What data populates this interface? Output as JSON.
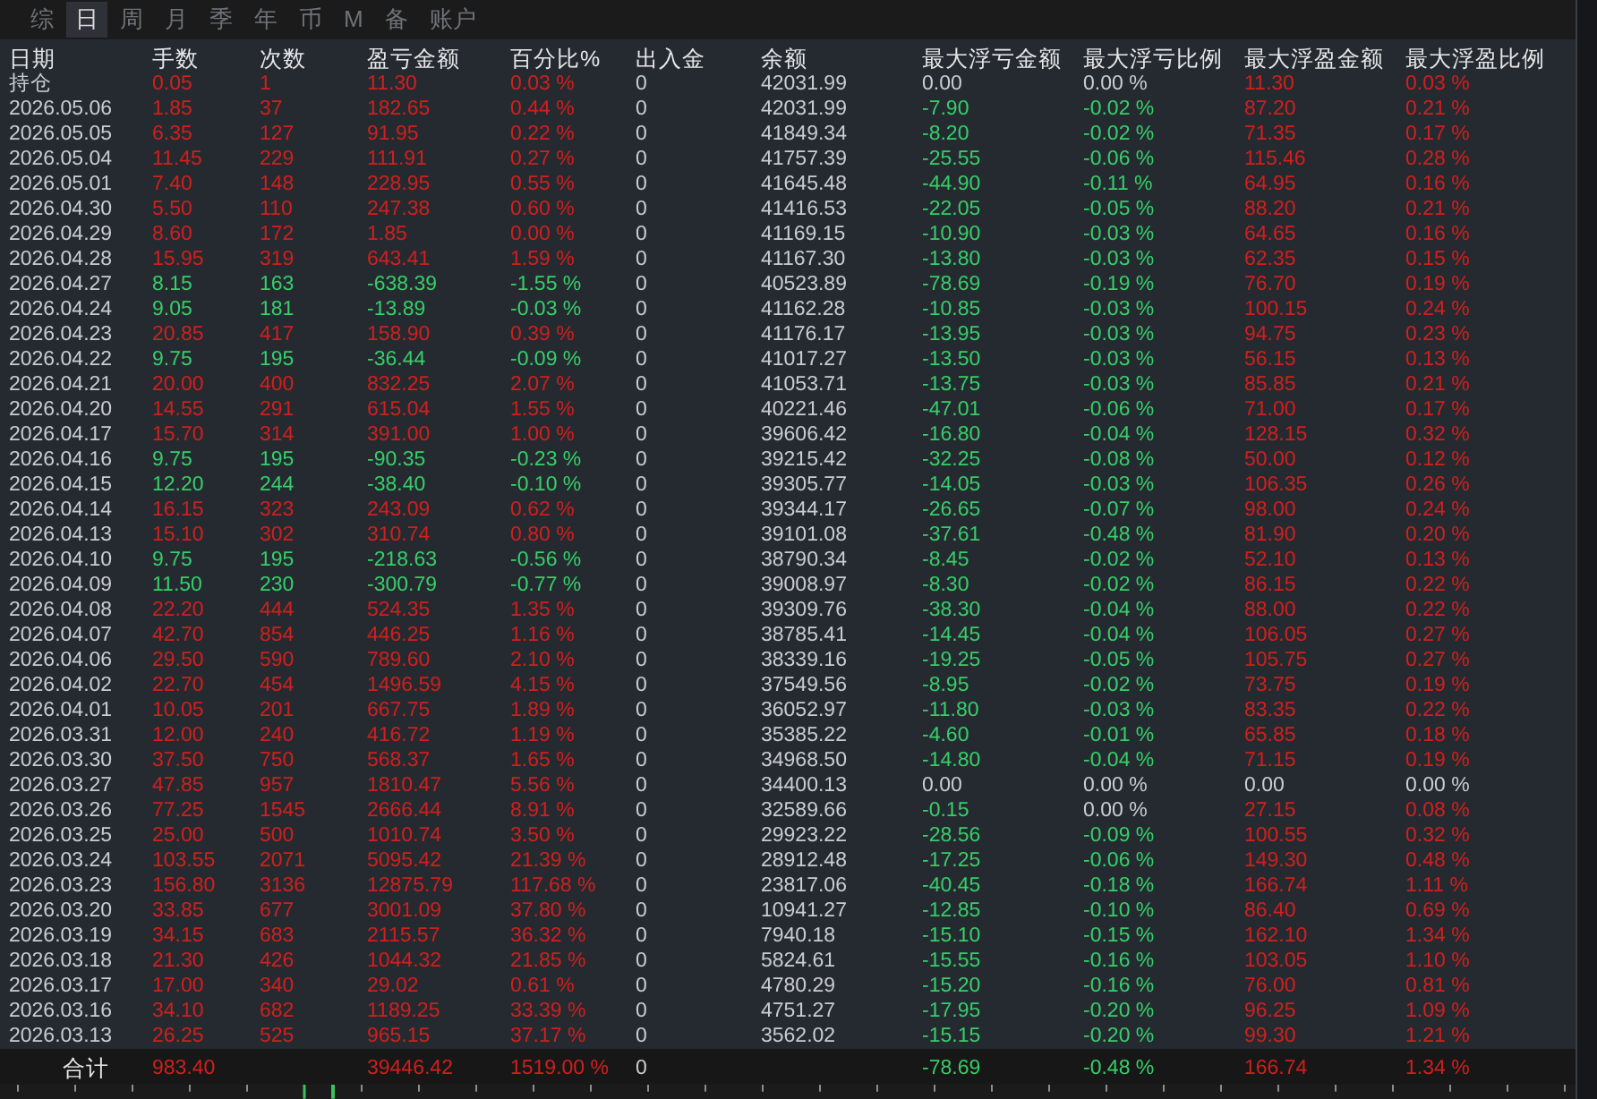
{
  "tabs": [
    {
      "label": "综",
      "selected": false
    },
    {
      "label": "日",
      "selected": true
    },
    {
      "label": "周",
      "selected": false
    },
    {
      "label": "月",
      "selected": false
    },
    {
      "label": "季",
      "selected": false
    },
    {
      "label": "年",
      "selected": false
    },
    {
      "label": "币",
      "selected": false
    },
    {
      "label": "M",
      "selected": false
    },
    {
      "label": "备",
      "selected": false
    },
    {
      "label": "账户",
      "selected": false
    }
  ],
  "columns": [
    "日期",
    "手数",
    "次数",
    "盈亏金额",
    "百分比%",
    "出入金",
    "余额",
    "最大浮亏金额",
    "最大浮亏比例",
    "最大浮盈金额",
    "最大浮盈比例"
  ],
  "rows": [
    {
      "cells": [
        "持仓",
        "0.05",
        "1",
        "11.30",
        "0.03 %",
        "0",
        "42031.99",
        "0.00",
        "0.00 %",
        "11.30",
        "0.03 %"
      ],
      "negative": false,
      "float_flat": [
        true,
        true,
        false,
        false
      ]
    },
    {
      "cells": [
        "2026.05.06",
        "1.85",
        "37",
        "182.65",
        "0.44 %",
        "0",
        "42031.99",
        "-7.90",
        "-0.02 %",
        "87.20",
        "0.21 %"
      ],
      "negative": false,
      "float_flat": [
        false,
        false,
        false,
        false
      ]
    },
    {
      "cells": [
        "2026.05.05",
        "6.35",
        "127",
        "91.95",
        "0.22 %",
        "0",
        "41849.34",
        "-8.20",
        "-0.02 %",
        "71.35",
        "0.17 %"
      ],
      "negative": false,
      "float_flat": [
        false,
        false,
        false,
        false
      ]
    },
    {
      "cells": [
        "2026.05.04",
        "11.45",
        "229",
        "111.91",
        "0.27 %",
        "0",
        "41757.39",
        "-25.55",
        "-0.06 %",
        "115.46",
        "0.28 %"
      ],
      "negative": false,
      "float_flat": [
        false,
        false,
        false,
        false
      ]
    },
    {
      "cells": [
        "2026.05.01",
        "7.40",
        "148",
        "228.95",
        "0.55 %",
        "0",
        "41645.48",
        "-44.90",
        "-0.11 %",
        "64.95",
        "0.16 %"
      ],
      "negative": false,
      "float_flat": [
        false,
        false,
        false,
        false
      ]
    },
    {
      "cells": [
        "2026.04.30",
        "5.50",
        "110",
        "247.38",
        "0.60 %",
        "0",
        "41416.53",
        "-22.05",
        "-0.05 %",
        "88.20",
        "0.21 %"
      ],
      "negative": false,
      "float_flat": [
        false,
        false,
        false,
        false
      ]
    },
    {
      "cells": [
        "2026.04.29",
        "8.60",
        "172",
        "1.85",
        "0.00 %",
        "0",
        "41169.15",
        "-10.90",
        "-0.03 %",
        "64.65",
        "0.16 %"
      ],
      "negative": false,
      "float_flat": [
        false,
        false,
        false,
        false
      ]
    },
    {
      "cells": [
        "2026.04.28",
        "15.95",
        "319",
        "643.41",
        "1.59 %",
        "0",
        "41167.30",
        "-13.80",
        "-0.03 %",
        "62.35",
        "0.15 %"
      ],
      "negative": false,
      "float_flat": [
        false,
        false,
        false,
        false
      ]
    },
    {
      "cells": [
        "2026.04.27",
        "8.15",
        "163",
        "-638.39",
        "-1.55 %",
        "0",
        "40523.89",
        "-78.69",
        "-0.19 %",
        "76.70",
        "0.19 %"
      ],
      "negative": true,
      "float_flat": [
        false,
        false,
        false,
        false
      ]
    },
    {
      "cells": [
        "2026.04.24",
        "9.05",
        "181",
        "-13.89",
        "-0.03 %",
        "0",
        "41162.28",
        "-10.85",
        "-0.03 %",
        "100.15",
        "0.24 %"
      ],
      "negative": true,
      "float_flat": [
        false,
        false,
        false,
        false
      ]
    },
    {
      "cells": [
        "2026.04.23",
        "20.85",
        "417",
        "158.90",
        "0.39 %",
        "0",
        "41176.17",
        "-13.95",
        "-0.03 %",
        "94.75",
        "0.23 %"
      ],
      "negative": false,
      "float_flat": [
        false,
        false,
        false,
        false
      ]
    },
    {
      "cells": [
        "2026.04.22",
        "9.75",
        "195",
        "-36.44",
        "-0.09 %",
        "0",
        "41017.27",
        "-13.50",
        "-0.03 %",
        "56.15",
        "0.13 %"
      ],
      "negative": true,
      "float_flat": [
        false,
        false,
        false,
        false
      ]
    },
    {
      "cells": [
        "2026.04.21",
        "20.00",
        "400",
        "832.25",
        "2.07 %",
        "0",
        "41053.71",
        "-13.75",
        "-0.03 %",
        "85.85",
        "0.21 %"
      ],
      "negative": false,
      "float_flat": [
        false,
        false,
        false,
        false
      ]
    },
    {
      "cells": [
        "2026.04.20",
        "14.55",
        "291",
        "615.04",
        "1.55 %",
        "0",
        "40221.46",
        "-47.01",
        "-0.06 %",
        "71.00",
        "0.17 %"
      ],
      "negative": false,
      "float_flat": [
        false,
        false,
        false,
        false
      ]
    },
    {
      "cells": [
        "2026.04.17",
        "15.70",
        "314",
        "391.00",
        "1.00 %",
        "0",
        "39606.42",
        "-16.80",
        "-0.04 %",
        "128.15",
        "0.32 %"
      ],
      "negative": false,
      "float_flat": [
        false,
        false,
        false,
        false
      ]
    },
    {
      "cells": [
        "2026.04.16",
        "9.75",
        "195",
        "-90.35",
        "-0.23 %",
        "0",
        "39215.42",
        "-32.25",
        "-0.08 %",
        "50.00",
        "0.12 %"
      ],
      "negative": true,
      "float_flat": [
        false,
        false,
        false,
        false
      ]
    },
    {
      "cells": [
        "2026.04.15",
        "12.20",
        "244",
        "-38.40",
        "-0.10 %",
        "0",
        "39305.77",
        "-14.05",
        "-0.03 %",
        "106.35",
        "0.26 %"
      ],
      "negative": true,
      "float_flat": [
        false,
        false,
        false,
        false
      ]
    },
    {
      "cells": [
        "2026.04.14",
        "16.15",
        "323",
        "243.09",
        "0.62 %",
        "0",
        "39344.17",
        "-26.65",
        "-0.07 %",
        "98.00",
        "0.24 %"
      ],
      "negative": false,
      "float_flat": [
        false,
        false,
        false,
        false
      ]
    },
    {
      "cells": [
        "2026.04.13",
        "15.10",
        "302",
        "310.74",
        "0.80 %",
        "0",
        "39101.08",
        "-37.61",
        "-0.48 %",
        "81.90",
        "0.20 %"
      ],
      "negative": false,
      "float_flat": [
        false,
        false,
        false,
        false
      ]
    },
    {
      "cells": [
        "2026.04.10",
        "9.75",
        "195",
        "-218.63",
        "-0.56 %",
        "0",
        "38790.34",
        "-8.45",
        "-0.02 %",
        "52.10",
        "0.13 %"
      ],
      "negative": true,
      "float_flat": [
        false,
        false,
        false,
        false
      ]
    },
    {
      "cells": [
        "2026.04.09",
        "11.50",
        "230",
        "-300.79",
        "-0.77 %",
        "0",
        "39008.97",
        "-8.30",
        "-0.02 %",
        "86.15",
        "0.22 %"
      ],
      "negative": true,
      "float_flat": [
        false,
        false,
        false,
        false
      ]
    },
    {
      "cells": [
        "2026.04.08",
        "22.20",
        "444",
        "524.35",
        "1.35 %",
        "0",
        "39309.76",
        "-38.30",
        "-0.04 %",
        "88.00",
        "0.22 %"
      ],
      "negative": false,
      "float_flat": [
        false,
        false,
        false,
        false
      ]
    },
    {
      "cells": [
        "2026.04.07",
        "42.70",
        "854",
        "446.25",
        "1.16 %",
        "0",
        "38785.41",
        "-14.45",
        "-0.04 %",
        "106.05",
        "0.27 %"
      ],
      "negative": false,
      "float_flat": [
        false,
        false,
        false,
        false
      ]
    },
    {
      "cells": [
        "2026.04.06",
        "29.50",
        "590",
        "789.60",
        "2.10 %",
        "0",
        "38339.16",
        "-19.25",
        "-0.05 %",
        "105.75",
        "0.27 %"
      ],
      "negative": false,
      "float_flat": [
        false,
        false,
        false,
        false
      ]
    },
    {
      "cells": [
        "2026.04.02",
        "22.70",
        "454",
        "1496.59",
        "4.15 %",
        "0",
        "37549.56",
        "-8.95",
        "-0.02 %",
        "73.75",
        "0.19 %"
      ],
      "negative": false,
      "float_flat": [
        false,
        false,
        false,
        false
      ]
    },
    {
      "cells": [
        "2026.04.01",
        "10.05",
        "201",
        "667.75",
        "1.89 %",
        "0",
        "36052.97",
        "-11.80",
        "-0.03 %",
        "83.35",
        "0.22 %"
      ],
      "negative": false,
      "float_flat": [
        false,
        false,
        false,
        false
      ]
    },
    {
      "cells": [
        "2026.03.31",
        "12.00",
        "240",
        "416.72",
        "1.19 %",
        "0",
        "35385.22",
        "-4.60",
        "-0.01 %",
        "65.85",
        "0.18 %"
      ],
      "negative": false,
      "float_flat": [
        false,
        false,
        false,
        false
      ]
    },
    {
      "cells": [
        "2026.03.30",
        "37.50",
        "750",
        "568.37",
        "1.65 %",
        "0",
        "34968.50",
        "-14.80",
        "-0.04 %",
        "71.15",
        "0.19 %"
      ],
      "negative": false,
      "float_flat": [
        false,
        false,
        false,
        false
      ]
    },
    {
      "cells": [
        "2026.03.27",
        "47.85",
        "957",
        "1810.47",
        "5.56 %",
        "0",
        "34400.13",
        "0.00",
        "0.00 %",
        "0.00",
        "0.00 %"
      ],
      "negative": false,
      "float_flat": [
        true,
        true,
        true,
        true
      ]
    },
    {
      "cells": [
        "2026.03.26",
        "77.25",
        "1545",
        "2666.44",
        "8.91 %",
        "0",
        "32589.66",
        "-0.15",
        "0.00 %",
        "27.15",
        "0.08 %"
      ],
      "negative": false,
      "float_flat": [
        false,
        true,
        false,
        false
      ]
    },
    {
      "cells": [
        "2026.03.25",
        "25.00",
        "500",
        "1010.74",
        "3.50 %",
        "0",
        "29923.22",
        "-28.56",
        "-0.09 %",
        "100.55",
        "0.32 %"
      ],
      "negative": false,
      "float_flat": [
        false,
        false,
        false,
        false
      ]
    },
    {
      "cells": [
        "2026.03.24",
        "103.55",
        "2071",
        "5095.42",
        "21.39 %",
        "0",
        "28912.48",
        "-17.25",
        "-0.06 %",
        "149.30",
        "0.48 %"
      ],
      "negative": false,
      "float_flat": [
        false,
        false,
        false,
        false
      ]
    },
    {
      "cells": [
        "2026.03.23",
        "156.80",
        "3136",
        "12875.79",
        "117.68 %",
        "0",
        "23817.06",
        "-40.45",
        "-0.18 %",
        "166.74",
        "1.11 %"
      ],
      "negative": false,
      "float_flat": [
        false,
        false,
        false,
        false
      ]
    },
    {
      "cells": [
        "2026.03.20",
        "33.85",
        "677",
        "3001.09",
        "37.80 %",
        "0",
        "10941.27",
        "-12.85",
        "-0.10 %",
        "86.40",
        "0.69 %"
      ],
      "negative": false,
      "float_flat": [
        false,
        false,
        false,
        false
      ]
    },
    {
      "cells": [
        "2026.03.19",
        "34.15",
        "683",
        "2115.57",
        "36.32 %",
        "0",
        "7940.18",
        "-15.10",
        "-0.15 %",
        "162.10",
        "1.34 %"
      ],
      "negative": false,
      "float_flat": [
        false,
        false,
        false,
        false
      ]
    },
    {
      "cells": [
        "2026.03.18",
        "21.30",
        "426",
        "1044.32",
        "21.85 %",
        "0",
        "5824.61",
        "-15.55",
        "-0.16 %",
        "103.05",
        "1.10 %"
      ],
      "negative": false,
      "float_flat": [
        false,
        false,
        false,
        false
      ]
    },
    {
      "cells": [
        "2026.03.17",
        "17.00",
        "340",
        "29.02",
        "0.61 %",
        "0",
        "4780.29",
        "-15.20",
        "-0.16 %",
        "76.00",
        "0.81 %"
      ],
      "negative": false,
      "float_flat": [
        false,
        false,
        false,
        false
      ]
    },
    {
      "cells": [
        "2026.03.16",
        "34.10",
        "682",
        "1189.25",
        "33.39 %",
        "0",
        "4751.27",
        "-17.95",
        "-0.20 %",
        "96.25",
        "1.09 %"
      ],
      "negative": false,
      "float_flat": [
        false,
        false,
        false,
        false
      ]
    },
    {
      "cells": [
        "2026.03.13",
        "26.25",
        "525",
        "965.15",
        "37.17 %",
        "0",
        "3562.02",
        "-15.15",
        "-0.20 %",
        "99.30",
        "1.21 %"
      ],
      "negative": false,
      "float_flat": [
        false,
        false,
        false,
        false
      ]
    }
  ],
  "total": {
    "label": "合计",
    "hands": "983.40",
    "pnl": "39446.42",
    "pct": "1519.00 %",
    "flow": "0",
    "max_loss": "-78.69",
    "max_loss_pct": "-0.48 %",
    "max_gain": "166.74",
    "max_gain_pct": "1.34 %",
    "negative": false,
    "float_flat": [
      false,
      false,
      false,
      false
    ]
  }
}
